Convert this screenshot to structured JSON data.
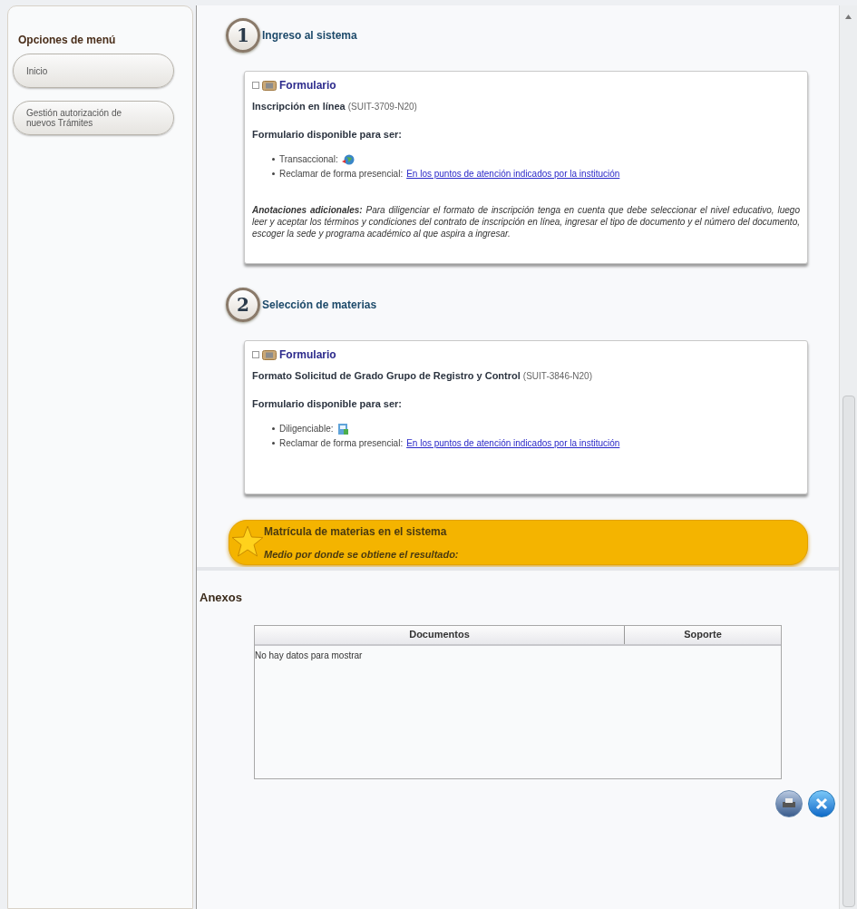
{
  "sidebar": {
    "title": "Opciones de menú",
    "items": [
      {
        "label": "Inicio"
      },
      {
        "label": "Gestión autorización de nuevos Trámites"
      }
    ]
  },
  "steps": [
    {
      "number": "1",
      "title": "Ingreso al sistema",
      "form": {
        "header": "Formulario",
        "name": "Inscripción en línea",
        "code": "(SUIT-3709-N20)",
        "available": "Formulario disponible para ser:",
        "options": [
          {
            "label": "Transaccional:",
            "kind": "globe"
          },
          {
            "label": "Reclamar de forma presencial:",
            "kind": "link",
            "link": "En los puntos de atención indicados por la institución"
          }
        ],
        "notes": "**Anotaciones adicionales:** Para diligenciar el formato de inscripción tenga en cuenta que debe seleccionar el nivel educativo, luego leer y aceptar los términos y condiciones del contrato de inscripción en línea, ingresar el tipo de documento y el número del documento, escoger la sede y programa académico al que aspira a ingresar."
      }
    },
    {
      "number": "2",
      "title": "Selección de materias",
      "form": {
        "header": "Formulario",
        "name": "Formato Solicitud de Grado Grupo de Registro y Control",
        "code": "(SUIT-3846-N20)",
        "available": "Formulario disponible para ser:",
        "options": [
          {
            "label": "Diligenciable:",
            "kind": "document"
          },
          {
            "label": "Reclamar de forma presencial:",
            "kind": "link",
            "link": "En los puntos de atención indicados por la institución"
          }
        ]
      }
    }
  ],
  "result": {
    "title": "Matrícula de materias en el sistema",
    "subtitle": "Medio por donde se obtiene el resultado:"
  },
  "annexes": {
    "title": "Anexos",
    "columns": [
      "Documentos",
      "Soporte"
    ],
    "empty": "No hay datos para mostrar"
  }
}
